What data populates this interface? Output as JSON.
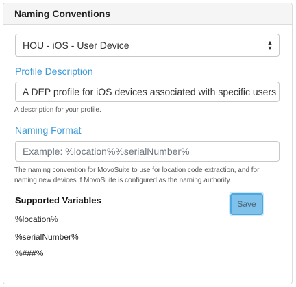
{
  "panel": {
    "title": "Naming Conventions"
  },
  "profile_select": {
    "selected": "HOU - iOS - User Device"
  },
  "profile_description": {
    "label": "Profile Description",
    "value": "A DEP profile for iOS devices associated with specific users at Hou",
    "help": "A description for your profile."
  },
  "naming_format": {
    "label": "Naming Format",
    "placeholder": "Example: %location%%serialNumber%",
    "help_line1": "The naming convention for MovoSuite to use for location code extraction, and for",
    "help_line2": "naming new devices if MovoSuite is configured as the naming authority."
  },
  "supported_variables": {
    "title": "Supported Variables",
    "items": [
      "%location%",
      "%serialNumber%",
      "%###%"
    ]
  },
  "save_button": {
    "label": "Save"
  },
  "colors": {
    "label_blue": "#3a9ad9",
    "save_bg": "#7ec1ea"
  }
}
